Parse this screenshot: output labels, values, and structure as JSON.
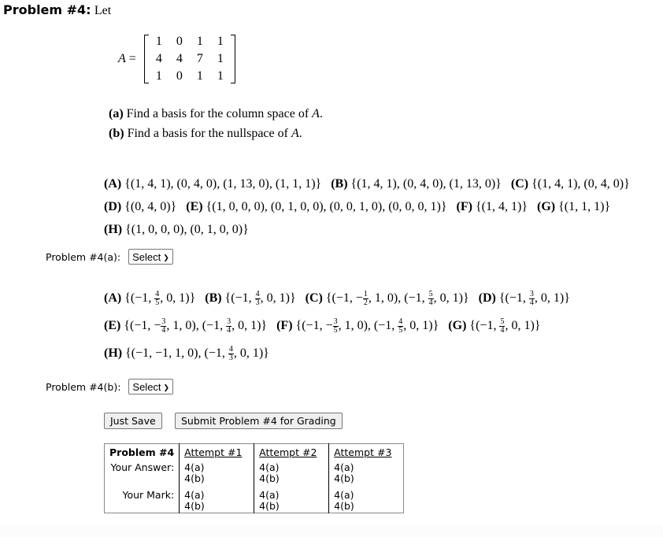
{
  "header": {
    "title": "Problem #4:",
    "intro": "Let"
  },
  "matrix": {
    "name": "A",
    "equals": "=",
    "rows": [
      [
        "1",
        "0",
        "1",
        "1"
      ],
      [
        "4",
        "4",
        "7",
        "1"
      ],
      [
        "1",
        "0",
        "1",
        "1"
      ]
    ]
  },
  "questions": [
    {
      "label": "(a)",
      "text": "Find a basis for the column space of ",
      "var": "A",
      "end": "."
    },
    {
      "label": "(b)",
      "text": "Find a basis for the nullspace of ",
      "var": "A",
      "end": "."
    }
  ],
  "part_a": {
    "choices": [
      {
        "label": "(A)",
        "value": "{(1, 4, 1), (0, 4, 0), (1, 13, 0), (1, 1, 1)}"
      },
      {
        "label": "(B)",
        "value": "{(1, 4, 1), (0, 4, 0), (1, 13, 0)}"
      },
      {
        "label": "(C)",
        "value": "{(1, 4, 1), (0, 4, 0)}"
      },
      {
        "label": "(D)",
        "value": "{(0, 4, 0)}"
      },
      {
        "label": "(E)",
        "value": "{(1, 0, 0, 0), (0, 1, 0, 0), (0, 0, 1, 0), (0, 0, 0, 1)}"
      },
      {
        "label": "(F)",
        "value": "{(1, 4, 1)}"
      },
      {
        "label": "(G)",
        "value": "{(1, 1, 1)}"
      },
      {
        "label": "(H)",
        "value": "{(1, 0, 0, 0), (0, 1, 0, 0)}"
      }
    ],
    "prompt": "Problem #4(a):",
    "select_value": "Select"
  },
  "part_b": {
    "choices": [
      {
        "label": "(A)",
        "parts": [
          "{(−1, ",
          {
            "n": "4",
            "d": "5"
          },
          ", 0, 1)}"
        ]
      },
      {
        "label": "(B)",
        "parts": [
          "{(−1, ",
          {
            "n": "4",
            "d": "3"
          },
          ", 0, 1)}"
        ]
      },
      {
        "label": "(C)",
        "parts": [
          "{(−1, −",
          {
            "n": "1",
            "d": "2"
          },
          ", 1, 0), (−1, ",
          {
            "n": "5",
            "d": "4"
          },
          ", 0, 1)}"
        ]
      },
      {
        "label": "(D)",
        "parts": [
          "{(−1, ",
          {
            "n": "3",
            "d": "4"
          },
          ", 0, 1)}"
        ]
      },
      {
        "label": "(E)",
        "parts": [
          "{(−1, −",
          {
            "n": "3",
            "d": "4"
          },
          ", 1, 0), (−1, ",
          {
            "n": "3",
            "d": "4"
          },
          ", 0, 1)}"
        ]
      },
      {
        "label": "(F)",
        "parts": [
          "{(−1, −",
          {
            "n": "3",
            "d": "5"
          },
          ", 1, 0), (−1, ",
          {
            "n": "4",
            "d": "5"
          },
          ", 0, 1)}"
        ]
      },
      {
        "label": "(G)",
        "parts": [
          "{(−1, ",
          {
            "n": "5",
            "d": "4"
          },
          ", 0, 1)}"
        ]
      },
      {
        "label": "(H)",
        "parts": [
          "{(−1, −1, 1, 0), (−1, ",
          {
            "n": "4",
            "d": "3"
          },
          ", 0, 1)}"
        ]
      }
    ],
    "prompt": "Problem #4(b):",
    "select_value": "Select"
  },
  "buttons": {
    "save": "Just Save",
    "submit": "Submit Problem #4 for Grading"
  },
  "results": {
    "corner": "Problem #4",
    "attempts": [
      "Attempt #1",
      "Attempt #2",
      "Attempt #3"
    ],
    "answer_label": "Your Answer:",
    "mark_label": "Your Mark:",
    "answer_cells": [
      "4(a)",
      "4(b)"
    ],
    "mark_cells": [
      "4(a)",
      "4(b)"
    ]
  }
}
